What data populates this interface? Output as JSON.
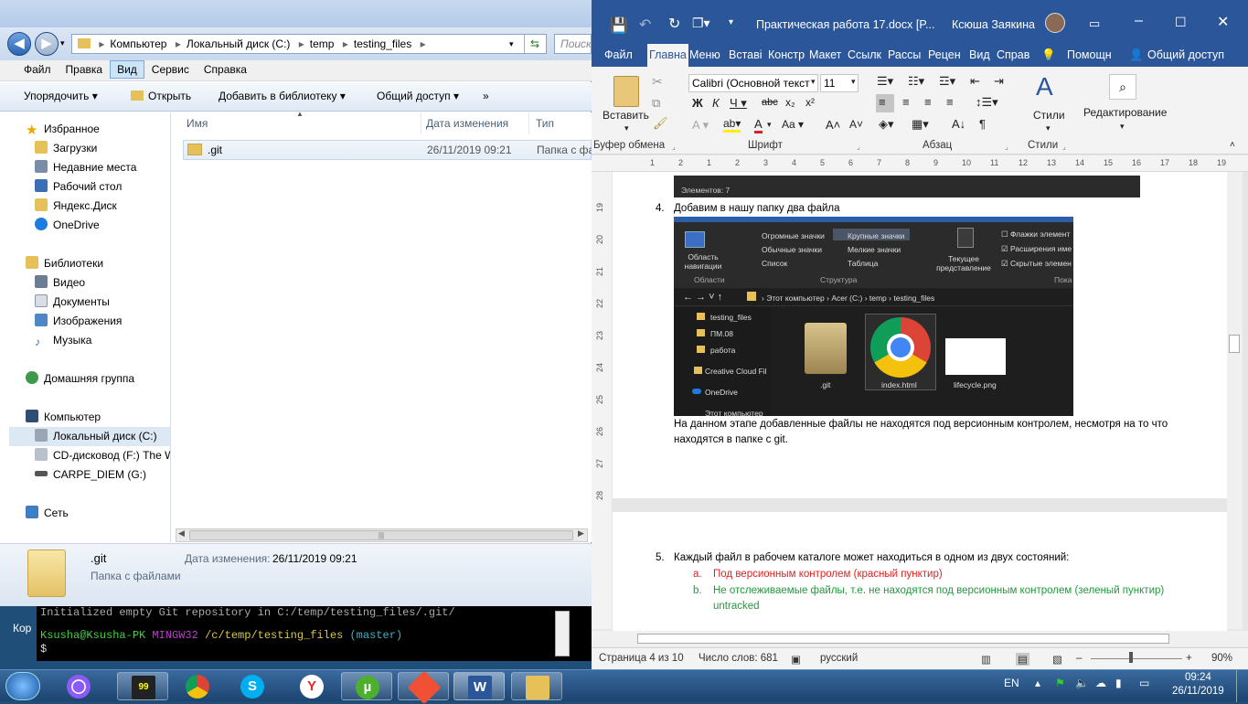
{
  "explorer": {
    "address": [
      "Компьютер",
      "Локальный диск (C:)",
      "temp",
      "testing_files"
    ],
    "search_placeholder": "Поиск: te",
    "menu": [
      "Файл",
      "Правка",
      "Вид",
      "Сервис",
      "Справка"
    ],
    "toolbar": {
      "organize": "Упорядочить",
      "open": "Открыть",
      "add_library": "Добавить в библиотеку",
      "share": "Общий доступ",
      "more": "»"
    },
    "nav": {
      "favorites": "Избранное",
      "favorites_items": [
        "Загрузки",
        "Недавние места",
        "Рабочий стол",
        "Яндекс.Диск",
        "OneDrive"
      ],
      "libraries": "Библиотеки",
      "libraries_items": [
        "Видео",
        "Документы",
        "Изображения",
        "Музыка"
      ],
      "homegroup": "Домашняя группа",
      "computer": "Компьютер",
      "computer_items": [
        "Локальный диск (C:)",
        "CD-дисковод (F:) The W",
        "CARPE_DIEM (G:)"
      ],
      "network": "Сеть"
    },
    "columns": {
      "name": "Имя",
      "date": "Дата изменения",
      "type": "Тип"
    },
    "file": {
      "name": ".git",
      "date": "26/11/2019 09:21",
      "type": "Папка с фай"
    },
    "details": {
      "name": ".git",
      "date_label": "Дата изменения:",
      "date": "26/11/2019 09:21",
      "kind": "Папка с файлами"
    }
  },
  "terminal": {
    "line0": "Initialized empty Git repository in C:/temp/testing_files/.git/",
    "left_label": "Кор",
    "user": "Ksusha@Ksusha-PK",
    "env": "MINGW32",
    "path": "/c/temp/testing_files",
    "branch": "(master)",
    "prompt": "$"
  },
  "word": {
    "title": "Практическая работа 17.docx [P...",
    "user": "Ксюша Заякина",
    "tabs": [
      "Файл",
      "Главна",
      "Меню",
      "Вставі",
      "Констр",
      "Макет",
      "Ссылк",
      "Рассы",
      "Рецен",
      "Вид",
      "Справ"
    ],
    "tell_me": "Помощн",
    "share": "Общий доступ",
    "ribbon": {
      "paste": "Вставить",
      "clipboard": "Буфер обмена",
      "font_name": "Calibri (Основной текст",
      "font_size": "11",
      "font_group": "Шрифт",
      "paragraph_group": "Абзац",
      "styles": "Стили",
      "styles_group": "Стили",
      "editing": "Редактирование"
    },
    "ruler_numbers": [
      "1",
      "2",
      "1",
      "2",
      "3",
      "4",
      "5",
      "6",
      "7",
      "8",
      "9",
      "10",
      "11",
      "12",
      "13",
      "14",
      "15",
      "16",
      "17",
      "18",
      "19"
    ],
    "vruler_numbers": [
      "19",
      "20",
      "21",
      "22",
      "23",
      "24",
      "25",
      "26",
      "27",
      "28"
    ],
    "doc": {
      "top_bar": "Элементов: 7",
      "item4_num": "4.",
      "item4": "Добавим в нашу папку два файла",
      "para1": "На данном этапе добавленные файлы не находятся под версионным контролем, несмотря на то что",
      "para2": "находятся в папке с git.",
      "item5_num": "5.",
      "item5": "Каждый файл в рабочем каталоге может находиться в одном из двух состояний:",
      "a_label": "a.",
      "a_text": "Под версионным контролем (красный пунктир)",
      "b_label": "b.",
      "b_text": "Не отслеживаемые файлы, т.е. не находятся под версионным контролем (зеленый пунктир)",
      "b_text2": "untracked"
    },
    "status": {
      "page": "Страница 4 из 10",
      "words": "Число слов: 681",
      "lang": "русский",
      "zoom": "90%"
    }
  },
  "shot": {
    "ribbon_items": [
      "Огромные значки",
      "Крупные значки",
      "Обычные значки",
      "Мелкие значки",
      "Список",
      "Таблица"
    ],
    "nav_area": "Область навигации",
    "areas": "Области",
    "structure": "Структура",
    "current_view": "Текущее представление",
    "checks": [
      "Флажки элемент",
      "Расширения име",
      "Скрытые элемен"
    ],
    "show": "Пока",
    "path": [
      "Этот компьютер",
      "Acer (C:)",
      "temp",
      "testing_files"
    ],
    "tree": [
      "testing_files",
      "ПМ.08",
      "работа",
      "Creative Cloud Fil",
      "OneDrive",
      "Этот компьютер"
    ],
    "files": [
      ".git",
      "index.html",
      "lifecycle.png"
    ]
  },
  "tray": {
    "lang": "EN",
    "time": "09:24",
    "date": "26/11/2019"
  },
  "colors": {
    "word_blue": "#2b579a",
    "red_text": "#e02020",
    "green_text": "#1e9b3a"
  }
}
